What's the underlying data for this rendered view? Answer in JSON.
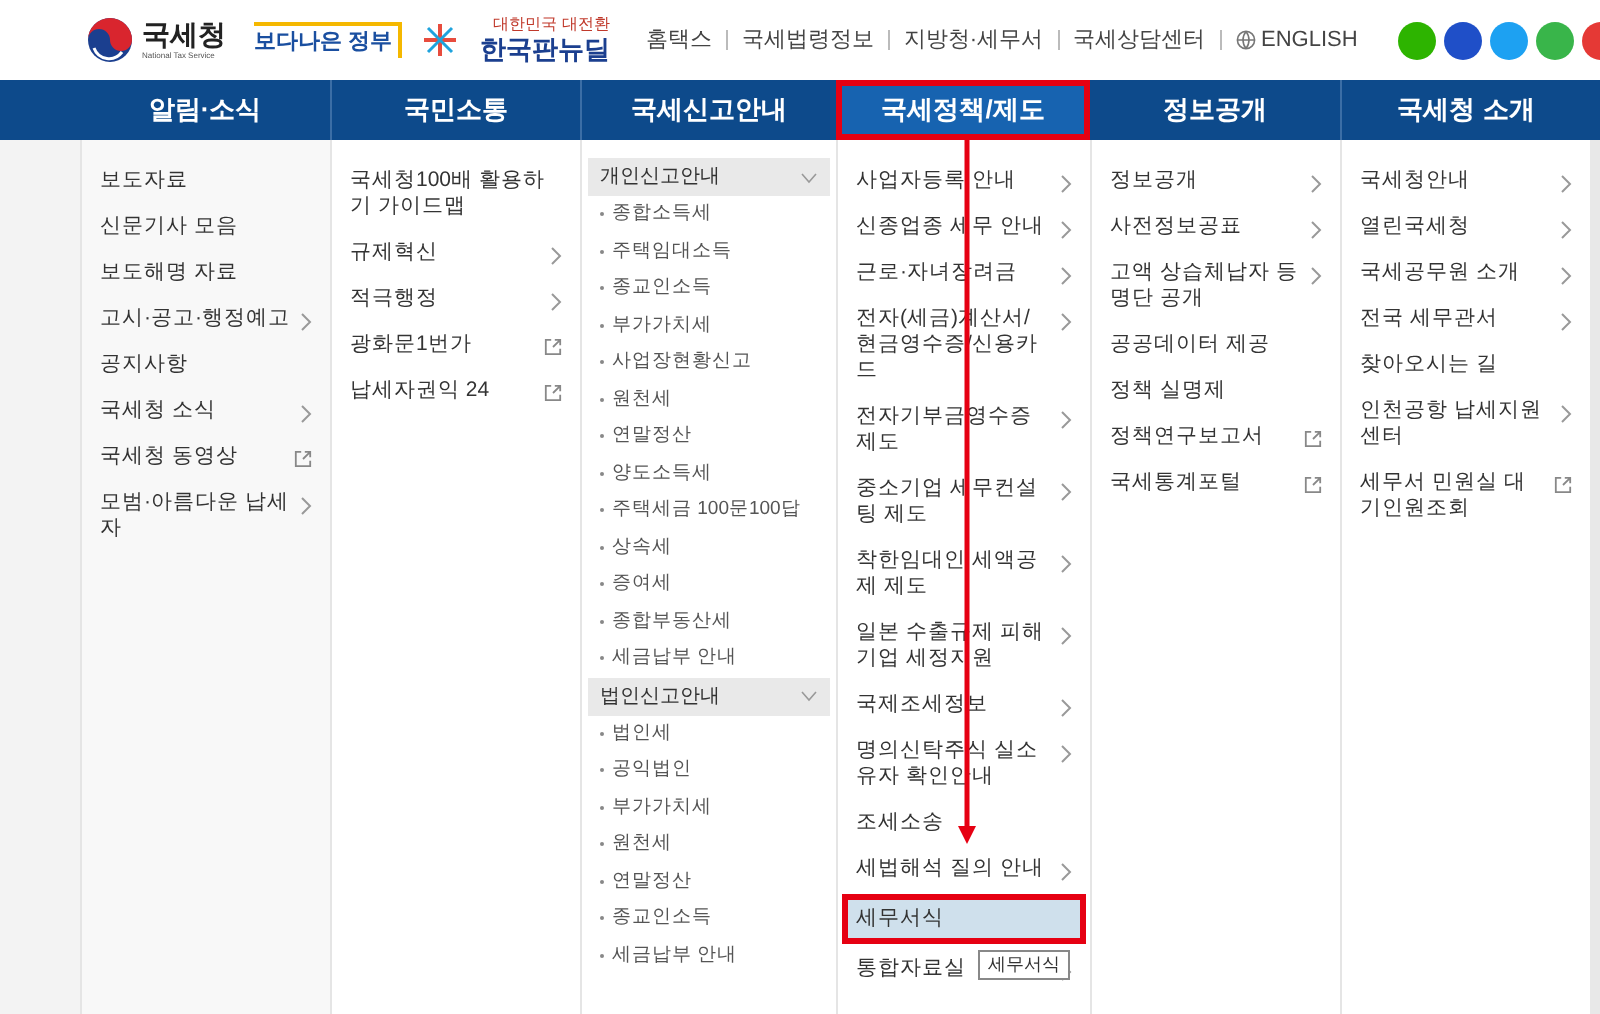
{
  "header": {
    "nts_logo": {
      "name": "국세청",
      "subtitle": "National Tax Service"
    },
    "gov_logo": {
      "text": "보다나은 정부"
    },
    "newdeal_logo": {
      "tagline": "대한민국 대전환",
      "name": "한국판뉴딜"
    },
    "top_links": [
      "홈택스",
      "국세법령정보",
      "지방청·세무서",
      "국세상담센터"
    ],
    "language": "ENGLISH"
  },
  "nav": {
    "tabs": [
      {
        "label": "알림·소식",
        "selected": false
      },
      {
        "label": "국민소통",
        "selected": false
      },
      {
        "label": "국세신고안내",
        "selected": false
      },
      {
        "label": "국세정책/제도",
        "selected": true
      },
      {
        "label": "정보공개",
        "selected": false
      },
      {
        "label": "국세청 소개",
        "selected": false
      }
    ]
  },
  "menu": {
    "columns": [
      {
        "kind": "list",
        "items": [
          {
            "label": "보도자료",
            "kind": "plain",
            "selected": false
          },
          {
            "label": "신문기사 모음",
            "kind": "plain",
            "selected": false
          },
          {
            "label": "보도해명 자료",
            "kind": "plain",
            "selected": false
          },
          {
            "label": "고시·공고·행정예고",
            "kind": "submenu",
            "selected": false
          },
          {
            "label": "공지사항",
            "kind": "plain",
            "selected": false
          },
          {
            "label": "국세청 소식",
            "kind": "submenu",
            "selected": false
          },
          {
            "label": "국세청 동영상",
            "kind": "external",
            "selected": false
          },
          {
            "label": "모범·아름다운 납세자",
            "kind": "submenu",
            "selected": false
          }
        ]
      },
      {
        "kind": "list",
        "items": [
          {
            "label": "국세청100배 활용하기 가이드맵",
            "kind": "plain",
            "selected": false
          },
          {
            "label": "규제혁신",
            "kind": "submenu",
            "selected": false
          },
          {
            "label": "적극행정",
            "kind": "submenu",
            "selected": false
          },
          {
            "label": "광화문1번가",
            "kind": "external",
            "selected": false
          },
          {
            "label": "납세자권익 24",
            "kind": "external",
            "selected": false
          }
        ]
      },
      {
        "kind": "sections",
        "sections": [
          {
            "title": "개인신고안내",
            "expanded": true,
            "items": [
              "종합소득세",
              "주택임대소득",
              "종교인소득",
              "부가가치세",
              "사업장현황신고",
              "원천세",
              "연말정산",
              "양도소득세",
              "주택세금 100문100답",
              "상속세",
              "증여세",
              "종합부동산세",
              "세금납부 안내"
            ]
          },
          {
            "title": "법인신고안내",
            "expanded": true,
            "items": [
              "법인세",
              "공익법인",
              "부가가치세",
              "원천세",
              "연말정산",
              "종교인소득",
              "세금납부 안내"
            ]
          }
        ]
      },
      {
        "kind": "list",
        "items": [
          {
            "label": "사업자등록 안내",
            "kind": "submenu",
            "selected": false
          },
          {
            "label": "신종업종 세무 안내",
            "kind": "submenu",
            "selected": false
          },
          {
            "label": "근로·자녀장려금",
            "kind": "submenu",
            "selected": false
          },
          {
            "label": "전자(세금)계산서/ 현금영수증/신용카드",
            "kind": "submenu",
            "selected": false
          },
          {
            "label": "전자기부금영수증 제도",
            "kind": "submenu",
            "selected": false
          },
          {
            "label": "중소기업 세무컨설팅 제도",
            "kind": "submenu",
            "selected": false
          },
          {
            "label": "착한임대인 세액공제 제도",
            "kind": "submenu",
            "selected": false
          },
          {
            "label": "일본 수출규제 피해기업 세정지원",
            "kind": "submenu",
            "selected": false
          },
          {
            "label": "국제조세정보",
            "kind": "submenu",
            "selected": false
          },
          {
            "label": "명의신탁주식 실소유자 확인안내",
            "kind": "submenu",
            "selected": false
          },
          {
            "label": "조세소송",
            "kind": "plain",
            "selected": false
          },
          {
            "label": "세법해석 질의 안내",
            "kind": "submenu",
            "selected": false
          },
          {
            "label": "세무서식",
            "kind": "plain",
            "selected": true
          },
          {
            "label": "통합자료실",
            "kind": "submenu",
            "selected": false,
            "tooltip": "세무서식"
          }
        ]
      },
      {
        "kind": "list",
        "items": [
          {
            "label": "정보공개",
            "kind": "submenu",
            "selected": false
          },
          {
            "label": "사전정보공표",
            "kind": "submenu",
            "selected": false
          },
          {
            "label": "고액 상습체납자 등 명단 공개",
            "kind": "submenu",
            "selected": false
          },
          {
            "label": "공공데이터 제공",
            "kind": "plain",
            "selected": false
          },
          {
            "label": "정책 실명제",
            "kind": "plain",
            "selected": false
          },
          {
            "label": "정책연구보고서",
            "kind": "external",
            "selected": false
          },
          {
            "label": "국세통계포털",
            "kind": "external",
            "selected": false
          }
        ]
      },
      {
        "kind": "list",
        "items": [
          {
            "label": "국세청안내",
            "kind": "submenu",
            "selected": false
          },
          {
            "label": "열린국세청",
            "kind": "submenu",
            "selected": false
          },
          {
            "label": "국세공무원 소개",
            "kind": "submenu",
            "selected": false
          },
          {
            "label": "전국 세무관서",
            "kind": "submenu",
            "selected": false
          },
          {
            "label": "찾아오시는 길",
            "kind": "plain",
            "selected": false
          },
          {
            "label": "인천공항 납세지원센터",
            "kind": "submenu",
            "selected": false
          },
          {
            "label": "세무서 민원실 대기인원조회",
            "kind": "external",
            "selected": false
          }
        ]
      }
    ]
  }
}
